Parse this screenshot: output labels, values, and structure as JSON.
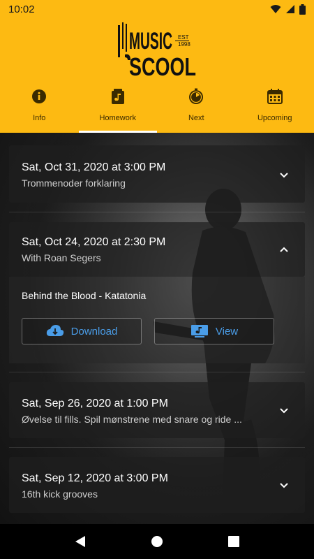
{
  "status": {
    "time": "10:02"
  },
  "brand": {
    "line1": "MUSIC",
    "line2": "SCOOL",
    "est": "EST",
    "year": "1998"
  },
  "tabs": [
    {
      "label": "Info",
      "icon": "info-icon"
    },
    {
      "label": "Homework",
      "icon": "music-note-icon",
      "active": true
    },
    {
      "label": "Next",
      "icon": "timer-icon"
    },
    {
      "label": "Upcoming",
      "icon": "calendar-icon"
    }
  ],
  "lessons": [
    {
      "date": "Sat, Oct 31, 2020 at 3:00 PM",
      "subtitle": "Trommenoder forklaring",
      "expanded": false
    },
    {
      "date": "Sat, Oct 24, 2020 at 2:30 PM",
      "subtitle": "With Roan Segers",
      "expanded": true,
      "song": "Behind the Blood - Katatonia",
      "download_label": "Download",
      "view_label": "View"
    },
    {
      "date": "Sat, Sep 26, 2020 at 1:00 PM",
      "subtitle": "Øvelse til fills. Spil mønstrene med snare og ride ...",
      "expanded": false
    },
    {
      "date": "Sat, Sep 12, 2020 at 3:00 PM",
      "subtitle": "16th kick grooves",
      "expanded": false
    }
  ],
  "colors": {
    "brand": "#fdba12",
    "accent": "#4a9de8"
  }
}
